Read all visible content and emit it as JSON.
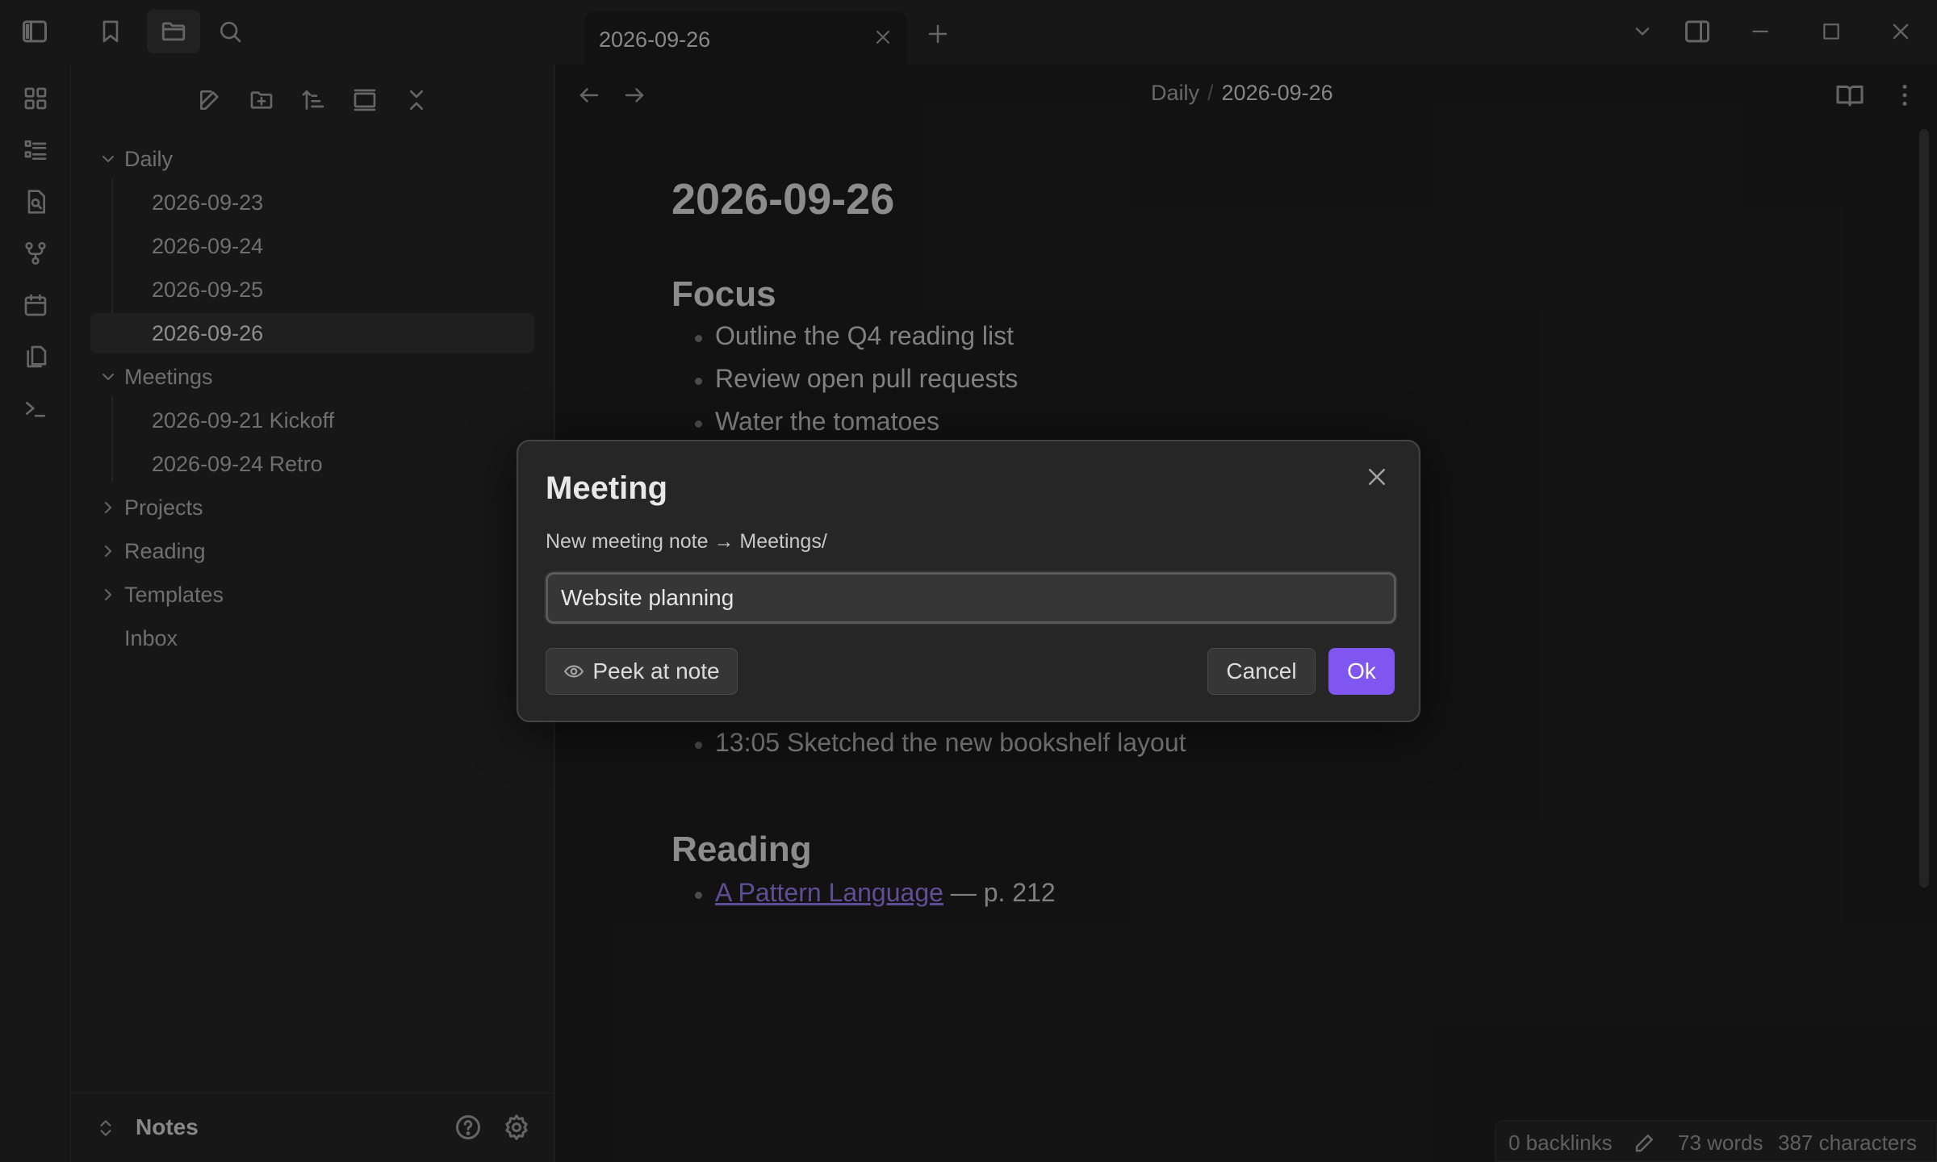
{
  "tab": {
    "title": "2026-09-26"
  },
  "breadcrumb": {
    "folder": "Daily",
    "separator": "/",
    "note": "2026-09-26"
  },
  "tree": {
    "items": [
      {
        "label": "Daily",
        "kind": "folder",
        "expanded": true
      },
      {
        "label": "2026-09-23",
        "kind": "file"
      },
      {
        "label": "2026-09-24",
        "kind": "file"
      },
      {
        "label": "2026-09-25",
        "kind": "file"
      },
      {
        "label": "2026-09-26",
        "kind": "file",
        "active": true
      },
      {
        "label": "Meetings",
        "kind": "folder",
        "expanded": true
      },
      {
        "label": "2026-09-21 Kickoff",
        "kind": "file"
      },
      {
        "label": "2026-09-24 Retro",
        "kind": "file"
      },
      {
        "label": "Projects",
        "kind": "folder",
        "expanded": false
      },
      {
        "label": "Reading",
        "kind": "folder",
        "expanded": false
      },
      {
        "label": "Templates",
        "kind": "folder",
        "expanded": false
      },
      {
        "label": "Inbox",
        "kind": "file"
      }
    ]
  },
  "vault": {
    "name": "Notes"
  },
  "note": {
    "title": "2026-09-26",
    "sections": [
      {
        "heading": "Focus",
        "items": [
          "Outline the Q4 reading list",
          "Review open pull requests",
          "Water the tomatoes"
        ]
      },
      {
        "heading": "",
        "items": [
          "13:05 Sketched the new bookshelf layout"
        ]
      },
      {
        "heading": "Reading",
        "items": []
      }
    ],
    "reading_link": "A Pattern Language",
    "reading_suffix": " — p. 212"
  },
  "modal": {
    "title": "Meeting",
    "description": "New meeting note → Meetings/",
    "input_value": "Website planning",
    "peek_label": "Peek at note",
    "cancel_label": "Cancel",
    "ok_label": "Ok"
  },
  "status": {
    "backlinks": "0 backlinks",
    "words": "73 words",
    "characters": "387 characters"
  },
  "colors": {
    "accent": "#7f57f0",
    "link": "#9a7ef0",
    "background": "#1e1e1e",
    "sidebar": "#262626"
  }
}
